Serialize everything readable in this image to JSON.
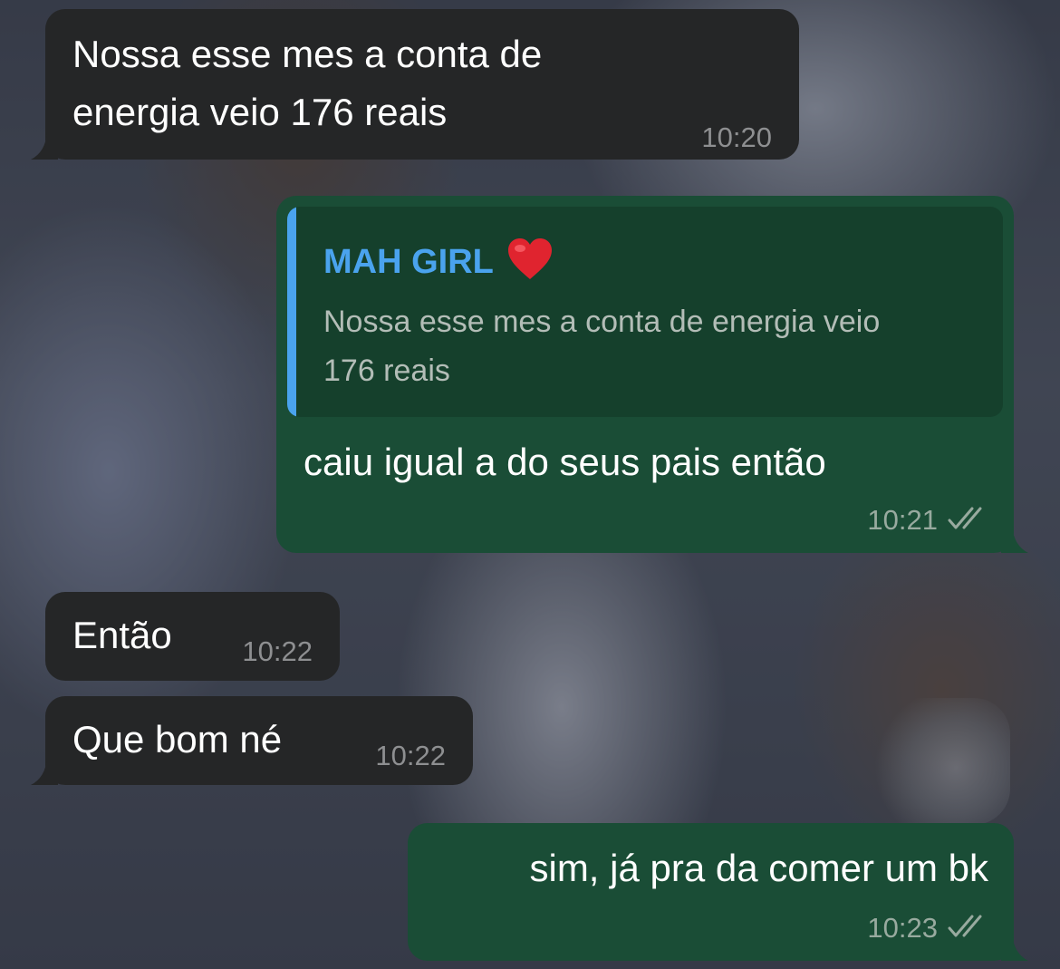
{
  "messages": [
    {
      "id": "m1",
      "direction": "incoming",
      "lines": [
        "Nossa esse mes a conta de",
        "energia veio 176 reais"
      ],
      "time": "10:20"
    },
    {
      "id": "m2",
      "direction": "outgoing",
      "reply_to": {
        "author": "MAH GIRL",
        "author_emoji": "heart-icon",
        "lines": [
          "Nossa esse mes a conta de energia veio",
          "176 reais"
        ]
      },
      "text": "caiu igual a do seus pais então",
      "time": "10:21",
      "status": "read"
    },
    {
      "id": "m3",
      "direction": "incoming",
      "text": "Então",
      "time": "10:22"
    },
    {
      "id": "m4",
      "direction": "incoming",
      "text": "Que bom né",
      "time": "10:22"
    },
    {
      "id": "m5",
      "direction": "outgoing",
      "text": "sim, já pra da comer um bk",
      "time": "10:23",
      "status": "read"
    }
  ],
  "colors": {
    "incoming_bubble": "#252627",
    "outgoing_bubble": "#1a4d36",
    "quote_background": "#15402c",
    "quote_accent": "#4aa3ee",
    "heart": "#e0242f"
  }
}
